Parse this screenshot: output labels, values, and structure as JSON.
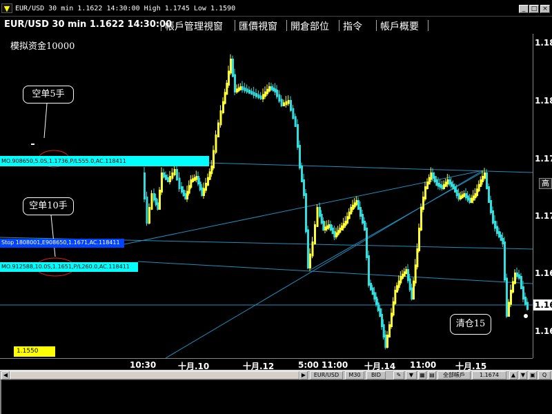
{
  "window": {
    "title": "EUR/USD 30 min 1.1622 14:30:00 High 1.1745 Low 1.1590",
    "minimize": "_",
    "maximize": "□",
    "close": "×"
  },
  "toolbar": {
    "symbol_info": "EUR/USD 30 min 1.1622 14:30:00",
    "menu": [
      "帳戶管理視窗",
      "匯價視窗",
      "開倉部位",
      "指令",
      "帳戶概要"
    ]
  },
  "chart": {
    "sim_label": "模拟资金10000",
    "price_ticks": [
      "1.18",
      "1.18",
      "1.17",
      "1.17",
      "1.16",
      "1.16"
    ],
    "current_price": "1.16",
    "high_label": "高",
    "time_ticks": [
      "10:30",
      "十月.10",
      "十月.12",
      "5:00 11:00",
      "十月.14",
      "11:00",
      "十月.15"
    ],
    "low_price_box": "1.1550",
    "callouts": {
      "short5": "空单5手",
      "short10": "空单10手",
      "close15": "清仓15"
    },
    "orders": {
      "mo1": "MO.908650,5.0S,1.1736,P/L555.0,AC.118411",
      "stop": "Stop 1808001,E908650,1.1671,AC.118411",
      "mo2": "MO.912588,10.0S,1.1651,P/L260.0,AC.118411"
    },
    "colors": {
      "up_bar": "#ffff33",
      "down_bar": "#33dddd",
      "order_bar": "#00ffff",
      "stop_bar": "#0044ff",
      "trendline": "#1f8fbf"
    }
  },
  "statusbar": {
    "symbol": "EUR/USD",
    "timeframe": "M30",
    "side": "BID",
    "account": "全部帳戶",
    "price": "1.1674"
  }
}
